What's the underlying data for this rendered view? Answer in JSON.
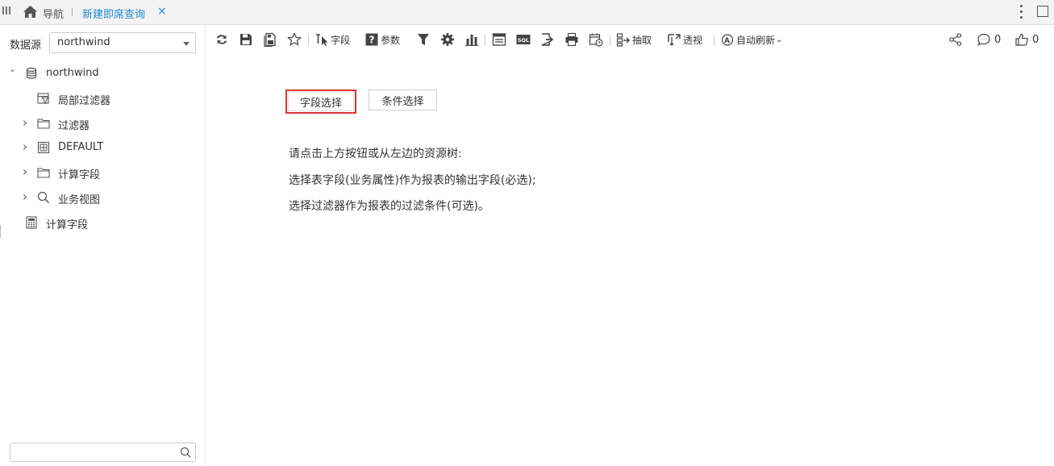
{
  "topbar": {
    "nav_label": "导航",
    "tab_label": "新建即席查询",
    "tab_close": "×"
  },
  "left": {
    "datasource_label": "数据源",
    "datasource_value": "northwind",
    "tree": [
      {
        "label": "northwind",
        "icon": "database-icon",
        "expander": "⌄"
      },
      {
        "label": "局部过滤器",
        "icon": "local-filter-icon",
        "expander": ""
      },
      {
        "label": "过滤器",
        "icon": "folder-icon",
        "expander": "›"
      },
      {
        "label": "DEFAULT",
        "icon": "table-icon",
        "expander": "›"
      },
      {
        "label": "计算字段",
        "icon": "folder-icon",
        "expander": "›"
      },
      {
        "label": "业务视图",
        "icon": "search-icon",
        "expander": "›"
      },
      {
        "label": "计算字段",
        "icon": "calculator-icon",
        "expander": ""
      }
    ],
    "search_placeholder": ""
  },
  "toolbar": {
    "field_label": "字段",
    "param_label": "参数",
    "extract_label": "抽取",
    "pivot_label": "透视",
    "auto_refresh_label": "自动刷新",
    "comment_count": "0",
    "like_count": "0",
    "icons": [
      "refresh-icon",
      "save-icon",
      "save-as-icon",
      "favorite-star-icon",
      "field-icon",
      "param-icon",
      "filter-icon",
      "settings-gear-icon",
      "bar-chart-icon",
      "layout-icon",
      "sql-icon",
      "export-icon",
      "print-icon",
      "schedule-icon",
      "extract-icon",
      "pivot-icon",
      "auto-refresh-icon",
      "share-icon",
      "comment-icon",
      "like-icon"
    ]
  },
  "main": {
    "field_select_button": "字段选择",
    "condition_select_button": "条件选择",
    "hint_lines": [
      "请点击上方按钮或从左边的资源树:",
      "选择表字段(业务属性)作为报表的输出字段(必选);",
      "选择过滤器作为报表的过滤条件(可选)。"
    ]
  },
  "colors": {
    "accent": "#1a8bd8",
    "highlight_border": "#dd3333"
  }
}
